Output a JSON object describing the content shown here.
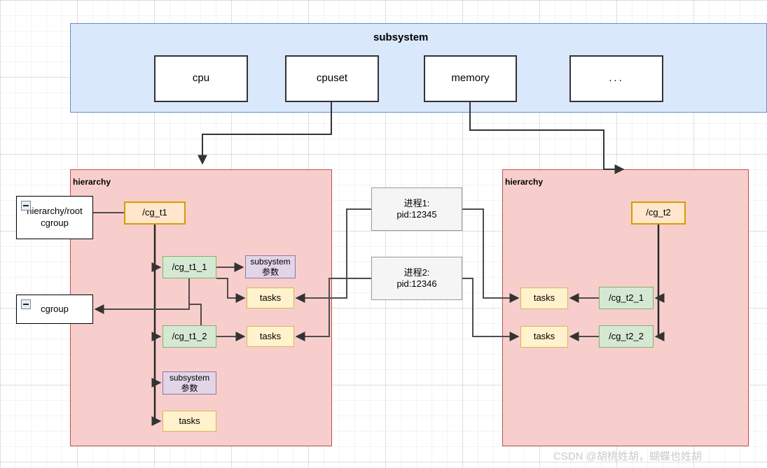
{
  "subsystem": {
    "title": "subsystem",
    "items": [
      {
        "label": "cpu"
      },
      {
        "label": "cpuset"
      },
      {
        "label": "memory"
      },
      {
        "label": "..."
      }
    ]
  },
  "notes": [
    {
      "label": "hierarchy/root\ncgroup",
      "line1": "hierarchy/root",
      "line2": "cgroup",
      "icon": "collapse-minus-icon"
    },
    {
      "label": "cgroup",
      "line1": "cgroup",
      "line2": "",
      "icon": "collapse-minus-icon"
    }
  ],
  "processes": [
    {
      "line1": "进程1:",
      "line2": "pid:12345"
    },
    {
      "line1": "进程2:",
      "line2": "pid:12346"
    }
  ],
  "hierarchy_left": {
    "title": "hierarchy",
    "root": "/cg_t1",
    "children": [
      "/cg_t1_1",
      "/cg_t1_2"
    ],
    "subsystem_params": {
      "line1": "subsystem",
      "line2": "参数"
    },
    "tasks": [
      "tasks",
      "tasks",
      "tasks"
    ]
  },
  "hierarchy_right": {
    "title": "hierarchy",
    "root": "/cg_t2",
    "children": [
      "/cg_t2_1",
      "/cg_t2_2"
    ],
    "tasks": [
      "tasks",
      "tasks"
    ]
  },
  "watermark": "CSDN @胡桃姓胡，蝴蝶也姓胡",
  "colors": {
    "subsystem_fill": "#dae8fc",
    "subsystem_stroke": "#6c8ebf",
    "hierarchy_fill": "#f8cecc",
    "hierarchy_stroke": "#b85450",
    "orange_fill": "#ffe6cc",
    "orange_stroke": "#d79b00",
    "green_fill": "#d5e8d4",
    "green_stroke": "#82b366",
    "yellow_fill": "#fff2cc",
    "yellow_stroke": "#d6b656",
    "purple_fill": "#e1d5e7",
    "purple_stroke": "#9673a6",
    "grey_fill": "#f5f5f5",
    "grey_stroke": "#999999",
    "wire": "#4d4d4d",
    "watermark": "#c9c9c9"
  }
}
